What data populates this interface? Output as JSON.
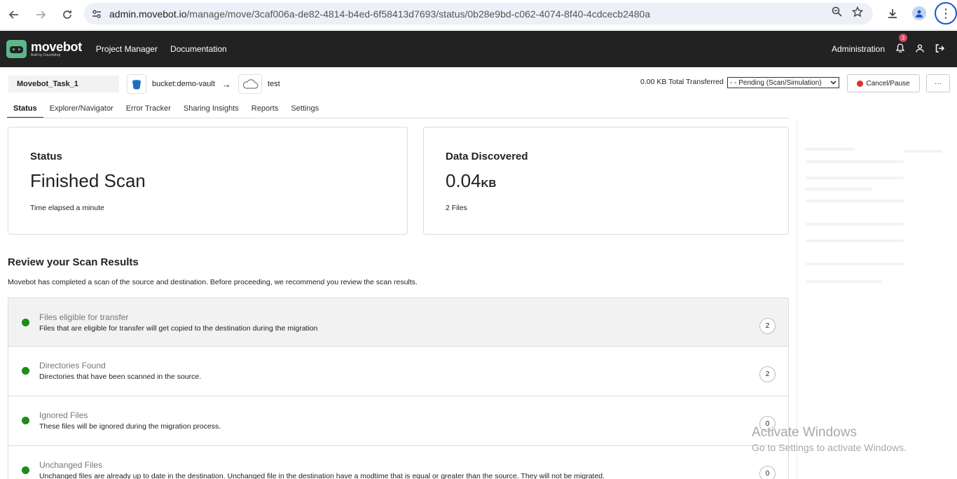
{
  "browser": {
    "url_host": "admin.movebot.io",
    "url_path": "/manage/move/3caf006a-de82-4814-b4ed-6f58413d7693/status/0b28e9bd-c062-4074-8f40-4cdcecb2480a"
  },
  "app": {
    "brand": "movebot",
    "brand_tagline": "Built by Couchdrop",
    "nav": [
      "Project Manager",
      "Documentation"
    ],
    "administration": "Administration",
    "notification_count": "3"
  },
  "task": {
    "name": "Movebot_Task_1",
    "source": "bucket:demo-vault",
    "destination": "test",
    "transferred": "0.00 KB Total Transferred",
    "state": "- - Pending (Scan/Simulation)",
    "cancel_label": "Cancel/Pause",
    "more_label": "···"
  },
  "tabs": [
    "Status",
    "Explorer/Navigator",
    "Error Tracker",
    "Sharing Insights",
    "Reports",
    "Settings"
  ],
  "status_card": {
    "title": "Status",
    "value": "Finished Scan",
    "sub": "Time elapsed a minute"
  },
  "data_card": {
    "title": "Data Discovered",
    "value": "0.04",
    "unit": "KB",
    "sub": "2 Files"
  },
  "review": {
    "title": "Review your Scan Results",
    "description": "Movebot has completed a scan of the source and destination. Before proceeding, we recommend you review the scan results.",
    "rows": [
      {
        "title": "Files eligible for transfer",
        "desc": "Files that are eligible for transfer will get copied to the destination during the migration",
        "count": "2"
      },
      {
        "title": "Directories Found",
        "desc": "Directories that have been scanned in the source.",
        "count": "2"
      },
      {
        "title": "Ignored Files",
        "desc": "These files will be ignored during the migration process.",
        "count": "0"
      },
      {
        "title": "Unchanged Files",
        "desc": "Unchanged files are already up to date in the destination. Unchanged file in the destination have a modtime that is equal or greater than the source. They will not be migrated.",
        "count": "0"
      }
    ]
  },
  "watermark": {
    "line1": "Activate Windows",
    "line2": "Go to Settings to activate Windows."
  },
  "colors": {
    "navbar": "#222222",
    "brand_green": "#5cb88a",
    "status_green": "#1f8a1f",
    "cancel_red": "#e03030"
  }
}
